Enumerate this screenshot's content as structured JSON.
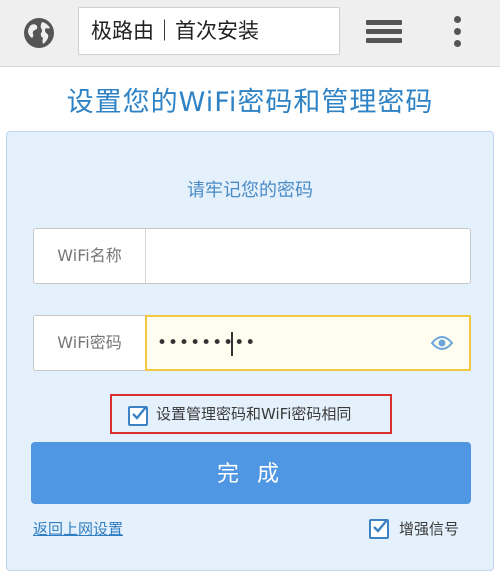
{
  "browser": {
    "url_text": "极路由｜首次安装",
    "icons": [
      "globe-icon",
      "tabs-icon",
      "menu-icon"
    ]
  },
  "page": {
    "title": "设置您的WiFi密码和管理密码"
  },
  "form": {
    "subtitle": "请牢记您的密码",
    "wifi_name": {
      "label": "WiFi名称",
      "value": ""
    },
    "wifi_password": {
      "label": "WiFi密码",
      "masked_value": "•••••••••"
    },
    "same_password_checkbox": {
      "label": "设置管理密码和WiFi密码相同",
      "checked": true
    },
    "submit_label": "完 成",
    "back_link": "返回上网设置",
    "boost_signal": {
      "label": "增强信号",
      "checked": true
    }
  },
  "colors": {
    "accent": "#4f97e2",
    "title": "#2f83c5",
    "highlight": "#d92f2f",
    "card_bg": "#e4f0fb"
  }
}
